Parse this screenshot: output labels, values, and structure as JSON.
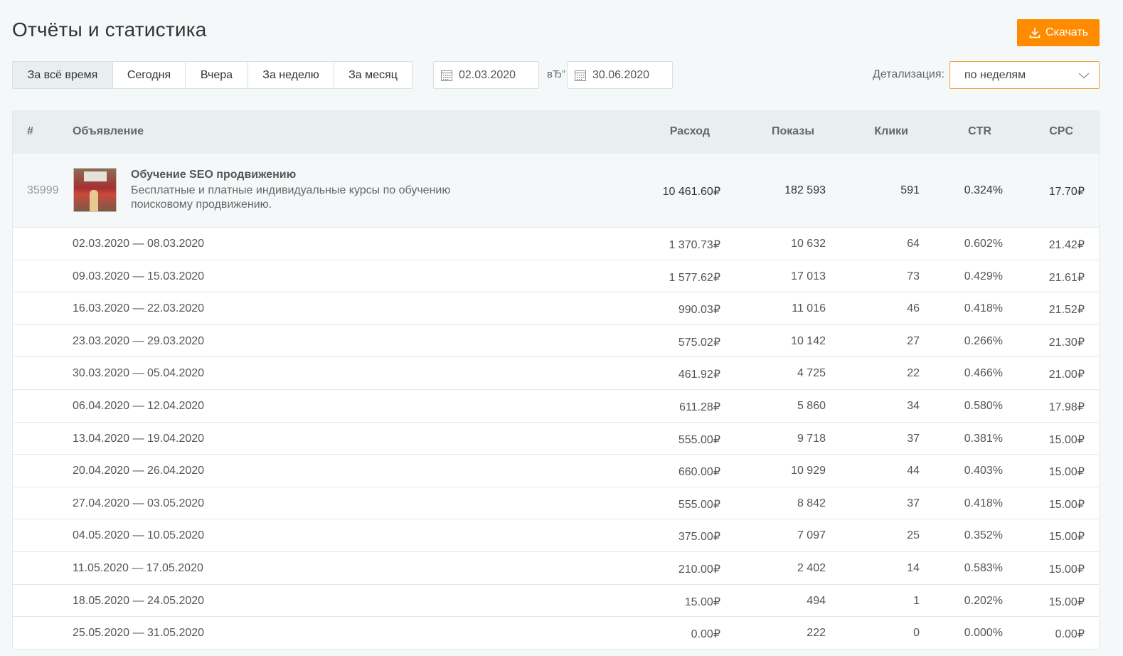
{
  "page": {
    "title": "Отчёты и статистика",
    "download_label": "Скачать"
  },
  "filters": {
    "period_tabs": [
      {
        "label": "За всё время",
        "active": true
      },
      {
        "label": "Сегодня",
        "active": false
      },
      {
        "label": "Вчера",
        "active": false
      },
      {
        "label": "За неделю",
        "active": false
      },
      {
        "label": "За месяц",
        "active": false
      }
    ],
    "date_from": "02.03.2020",
    "date_separator": "вЂ”",
    "date_to": "30.06.2020",
    "detail_label": "Детализация:",
    "detail_value": "по неделям"
  },
  "table": {
    "headers": {
      "num": "#",
      "ad": "Объявление",
      "spend": "Расход",
      "views": "Показы",
      "clicks": "Клики",
      "ctr": "CTR",
      "cpc": "CPC"
    },
    "ad": {
      "id": "35999",
      "title": "Обучение SEO продвижению",
      "description": "Бесплатные и платные индивидуальные курсы по обучению поисковому продвижению.",
      "spend": "10 461.60₽",
      "views": "182 593",
      "clicks": "591",
      "ctr": "0.324%",
      "cpc": "17.70₽"
    },
    "rows": [
      {
        "period": "02.03.2020 — 08.03.2020",
        "spend": "1 370.73₽",
        "views": "10 632",
        "clicks": "64",
        "ctr": "0.602%",
        "cpc": "21.42₽"
      },
      {
        "period": "09.03.2020 — 15.03.2020",
        "spend": "1 577.62₽",
        "views": "17 013",
        "clicks": "73",
        "ctr": "0.429%",
        "cpc": "21.61₽"
      },
      {
        "period": "16.03.2020 — 22.03.2020",
        "spend": "990.03₽",
        "views": "11 016",
        "clicks": "46",
        "ctr": "0.418%",
        "cpc": "21.52₽"
      },
      {
        "period": "23.03.2020 — 29.03.2020",
        "spend": "575.02₽",
        "views": "10 142",
        "clicks": "27",
        "ctr": "0.266%",
        "cpc": "21.30₽"
      },
      {
        "period": "30.03.2020 — 05.04.2020",
        "spend": "461.92₽",
        "views": "4 725",
        "clicks": "22",
        "ctr": "0.466%",
        "cpc": "21.00₽"
      },
      {
        "period": "06.04.2020 — 12.04.2020",
        "spend": "611.28₽",
        "views": "5 860",
        "clicks": "34",
        "ctr": "0.580%",
        "cpc": "17.98₽"
      },
      {
        "period": "13.04.2020 — 19.04.2020",
        "spend": "555.00₽",
        "views": "9 718",
        "clicks": "37",
        "ctr": "0.381%",
        "cpc": "15.00₽"
      },
      {
        "period": "20.04.2020 — 26.04.2020",
        "spend": "660.00₽",
        "views": "10 929",
        "clicks": "44",
        "ctr": "0.403%",
        "cpc": "15.00₽"
      },
      {
        "period": "27.04.2020 — 03.05.2020",
        "spend": "555.00₽",
        "views": "8 842",
        "clicks": "37",
        "ctr": "0.418%",
        "cpc": "15.00₽"
      },
      {
        "period": "04.05.2020 — 10.05.2020",
        "spend": "375.00₽",
        "views": "7 097",
        "clicks": "25",
        "ctr": "0.352%",
        "cpc": "15.00₽"
      },
      {
        "period": "11.05.2020 — 17.05.2020",
        "spend": "210.00₽",
        "views": "2 402",
        "clicks": "14",
        "ctr": "0.583%",
        "cpc": "15.00₽"
      },
      {
        "period": "18.05.2020 — 24.05.2020",
        "spend": "15.00₽",
        "views": "494",
        "clicks": "1",
        "ctr": "0.202%",
        "cpc": "15.00₽"
      },
      {
        "period": "25.05.2020 — 31.05.2020",
        "spend": "0.00₽",
        "views": "222",
        "clicks": "0",
        "ctr": "0.000%",
        "cpc": "0.00₽"
      }
    ]
  },
  "colors": {
    "accent": "#ff8c00",
    "select_border": "#f0a030",
    "header_bg": "#e9eff1",
    "page_bg": "#f5f8f9"
  },
  "icons": {
    "download": "download-icon",
    "calendar": "calendar-icon",
    "chevron": "chevron-down-icon",
    "ad_image": "ad-thumbnail"
  }
}
